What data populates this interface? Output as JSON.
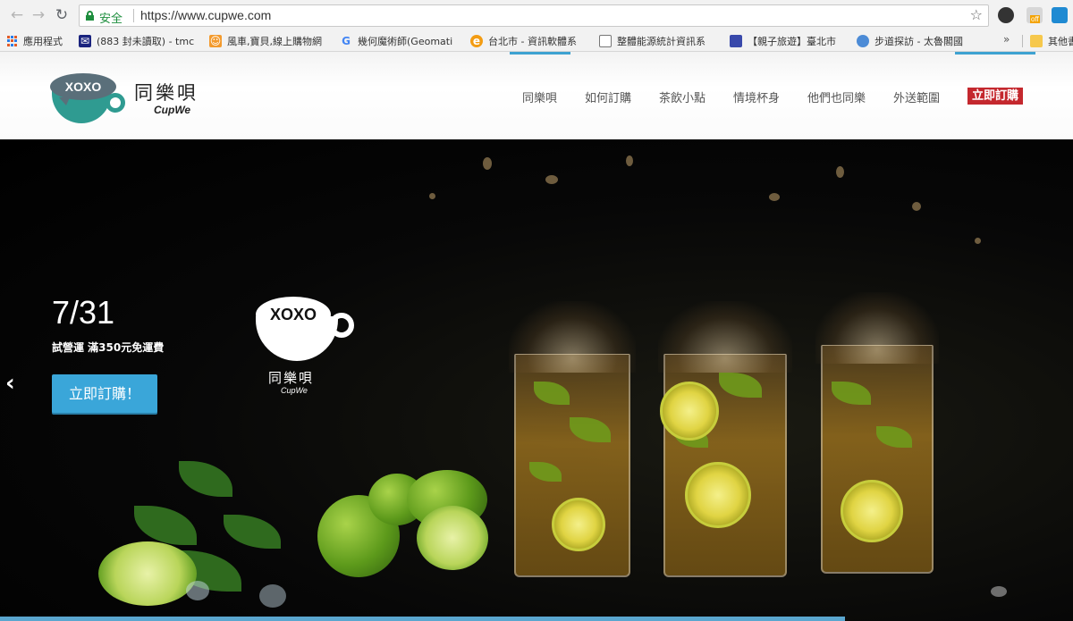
{
  "browser": {
    "secure_label": "安全",
    "url": "https://www.cupwe.com",
    "bookmarks": [
      {
        "label": "應用程式",
        "icon": "apps-grid-icon"
      },
      {
        "label": "(883 封未讀取) - tmc",
        "icon": "mail-icon",
        "color": "#1a237e"
      },
      {
        "label": "風車,寶貝,線上購物網",
        "icon": "shop-icon",
        "color": "#f39a2d"
      },
      {
        "label": "幾何魔術師(Geomati",
        "icon": "google-icon",
        "color": "#4285f4"
      },
      {
        "label": "台北市 - 資訊軟體系",
        "icon": "e-icon",
        "color": "#f39c12"
      },
      {
        "label": "整體能源統計資訊系",
        "icon": "document-icon",
        "color": "#777777"
      },
      {
        "label": "【親子旅遊】臺北市",
        "icon": "blue-book-icon",
        "color": "#3949ab"
      },
      {
        "label": "步道探訪 - 太魯閣國",
        "icon": "globe-icon",
        "color": "#4c8bd6"
      },
      {
        "label": "其他書",
        "icon": "folder-icon",
        "color": "#f6c84c"
      }
    ],
    "more_label": "»"
  },
  "site": {
    "logo": {
      "bubble": "XOXO",
      "title": "同樂唄",
      "subtitle": "CupWe"
    },
    "nav": [
      "同樂唄",
      "如何訂購",
      "茶飲小點",
      "情境杯身",
      "他們也同樂",
      "外送範圍"
    ],
    "nav_cta": "立即訂購",
    "accent_color": "#3aa6d9",
    "cta_color": "#c4282e"
  },
  "hero": {
    "date": "7/31",
    "note": "試營運 滿350元免運費",
    "button": "立即訂購！",
    "prev_arrow": "‹",
    "logo": {
      "bubble": "XOXO",
      "title": "同樂唄",
      "subtitle": "CupWe"
    }
  }
}
